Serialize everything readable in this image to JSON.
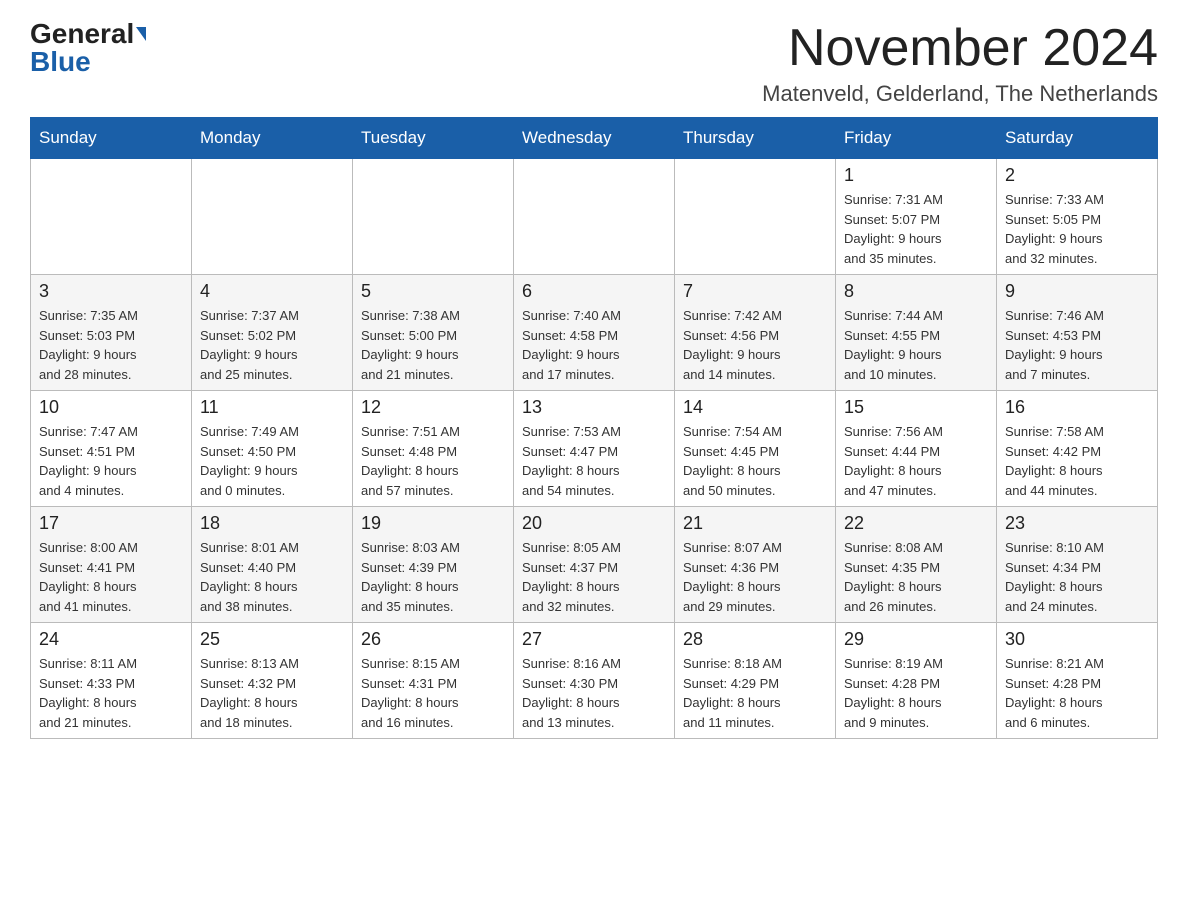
{
  "logo": {
    "general": "General",
    "blue": "Blue"
  },
  "header": {
    "month": "November 2024",
    "location": "Matenveld, Gelderland, The Netherlands"
  },
  "days_of_week": [
    "Sunday",
    "Monday",
    "Tuesday",
    "Wednesday",
    "Thursday",
    "Friday",
    "Saturday"
  ],
  "weeks": [
    [
      {
        "day": "",
        "info": ""
      },
      {
        "day": "",
        "info": ""
      },
      {
        "day": "",
        "info": ""
      },
      {
        "day": "",
        "info": ""
      },
      {
        "day": "",
        "info": ""
      },
      {
        "day": "1",
        "info": "Sunrise: 7:31 AM\nSunset: 5:07 PM\nDaylight: 9 hours\nand 35 minutes."
      },
      {
        "day": "2",
        "info": "Sunrise: 7:33 AM\nSunset: 5:05 PM\nDaylight: 9 hours\nand 32 minutes."
      }
    ],
    [
      {
        "day": "3",
        "info": "Sunrise: 7:35 AM\nSunset: 5:03 PM\nDaylight: 9 hours\nand 28 minutes."
      },
      {
        "day": "4",
        "info": "Sunrise: 7:37 AM\nSunset: 5:02 PM\nDaylight: 9 hours\nand 25 minutes."
      },
      {
        "day": "5",
        "info": "Sunrise: 7:38 AM\nSunset: 5:00 PM\nDaylight: 9 hours\nand 21 minutes."
      },
      {
        "day": "6",
        "info": "Sunrise: 7:40 AM\nSunset: 4:58 PM\nDaylight: 9 hours\nand 17 minutes."
      },
      {
        "day": "7",
        "info": "Sunrise: 7:42 AM\nSunset: 4:56 PM\nDaylight: 9 hours\nand 14 minutes."
      },
      {
        "day": "8",
        "info": "Sunrise: 7:44 AM\nSunset: 4:55 PM\nDaylight: 9 hours\nand 10 minutes."
      },
      {
        "day": "9",
        "info": "Sunrise: 7:46 AM\nSunset: 4:53 PM\nDaylight: 9 hours\nand 7 minutes."
      }
    ],
    [
      {
        "day": "10",
        "info": "Sunrise: 7:47 AM\nSunset: 4:51 PM\nDaylight: 9 hours\nand 4 minutes."
      },
      {
        "day": "11",
        "info": "Sunrise: 7:49 AM\nSunset: 4:50 PM\nDaylight: 9 hours\nand 0 minutes."
      },
      {
        "day": "12",
        "info": "Sunrise: 7:51 AM\nSunset: 4:48 PM\nDaylight: 8 hours\nand 57 minutes."
      },
      {
        "day": "13",
        "info": "Sunrise: 7:53 AM\nSunset: 4:47 PM\nDaylight: 8 hours\nand 54 minutes."
      },
      {
        "day": "14",
        "info": "Sunrise: 7:54 AM\nSunset: 4:45 PM\nDaylight: 8 hours\nand 50 minutes."
      },
      {
        "day": "15",
        "info": "Sunrise: 7:56 AM\nSunset: 4:44 PM\nDaylight: 8 hours\nand 47 minutes."
      },
      {
        "day": "16",
        "info": "Sunrise: 7:58 AM\nSunset: 4:42 PM\nDaylight: 8 hours\nand 44 minutes."
      }
    ],
    [
      {
        "day": "17",
        "info": "Sunrise: 8:00 AM\nSunset: 4:41 PM\nDaylight: 8 hours\nand 41 minutes."
      },
      {
        "day": "18",
        "info": "Sunrise: 8:01 AM\nSunset: 4:40 PM\nDaylight: 8 hours\nand 38 minutes."
      },
      {
        "day": "19",
        "info": "Sunrise: 8:03 AM\nSunset: 4:39 PM\nDaylight: 8 hours\nand 35 minutes."
      },
      {
        "day": "20",
        "info": "Sunrise: 8:05 AM\nSunset: 4:37 PM\nDaylight: 8 hours\nand 32 minutes."
      },
      {
        "day": "21",
        "info": "Sunrise: 8:07 AM\nSunset: 4:36 PM\nDaylight: 8 hours\nand 29 minutes."
      },
      {
        "day": "22",
        "info": "Sunrise: 8:08 AM\nSunset: 4:35 PM\nDaylight: 8 hours\nand 26 minutes."
      },
      {
        "day": "23",
        "info": "Sunrise: 8:10 AM\nSunset: 4:34 PM\nDaylight: 8 hours\nand 24 minutes."
      }
    ],
    [
      {
        "day": "24",
        "info": "Sunrise: 8:11 AM\nSunset: 4:33 PM\nDaylight: 8 hours\nand 21 minutes."
      },
      {
        "day": "25",
        "info": "Sunrise: 8:13 AM\nSunset: 4:32 PM\nDaylight: 8 hours\nand 18 minutes."
      },
      {
        "day": "26",
        "info": "Sunrise: 8:15 AM\nSunset: 4:31 PM\nDaylight: 8 hours\nand 16 minutes."
      },
      {
        "day": "27",
        "info": "Sunrise: 8:16 AM\nSunset: 4:30 PM\nDaylight: 8 hours\nand 13 minutes."
      },
      {
        "day": "28",
        "info": "Sunrise: 8:18 AM\nSunset: 4:29 PM\nDaylight: 8 hours\nand 11 minutes."
      },
      {
        "day": "29",
        "info": "Sunrise: 8:19 AM\nSunset: 4:28 PM\nDaylight: 8 hours\nand 9 minutes."
      },
      {
        "day": "30",
        "info": "Sunrise: 8:21 AM\nSunset: 4:28 PM\nDaylight: 8 hours\nand 6 minutes."
      }
    ]
  ]
}
